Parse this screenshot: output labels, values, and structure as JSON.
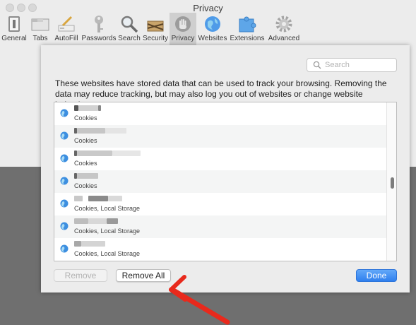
{
  "window": {
    "title": "Privacy"
  },
  "toolbar": {
    "items": [
      {
        "label": "General",
        "icon": "general-icon"
      },
      {
        "label": "Tabs",
        "icon": "tabs-icon"
      },
      {
        "label": "AutoFill",
        "icon": "autofill-icon"
      },
      {
        "label": "Passwords",
        "icon": "key-icon"
      },
      {
        "label": "Search",
        "icon": "magnifier-icon"
      },
      {
        "label": "Security",
        "icon": "security-icon"
      },
      {
        "label": "Privacy",
        "icon": "hand-icon",
        "selected": true
      },
      {
        "label": "Websites",
        "icon": "globe-icon"
      },
      {
        "label": "Extensions",
        "icon": "puzzle-icon"
      },
      {
        "label": "Advanced",
        "icon": "gear-icon"
      }
    ]
  },
  "sheet": {
    "search": {
      "placeholder": "Search"
    },
    "description": "These websites have stored data that can be used to track your browsing. Removing the data may reduce tracking, but may also log you out of websites or change website behavior.",
    "rows": [
      {
        "kinds": "Cookies"
      },
      {
        "kinds": "Cookies"
      },
      {
        "kinds": "Cookies"
      },
      {
        "kinds": "Cookies"
      },
      {
        "kinds": "Cookies, Local Storage"
      },
      {
        "kinds": "Cookies, Local Storage"
      },
      {
        "kinds": "Cookies, Local Storage"
      }
    ],
    "buttons": {
      "remove": "Remove",
      "remove_all": "Remove All",
      "done": "Done"
    }
  },
  "colors": {
    "accent": "#2f7fee",
    "annotation_arrow": "#e8291c",
    "selected_tab": "#cfcfcf"
  }
}
